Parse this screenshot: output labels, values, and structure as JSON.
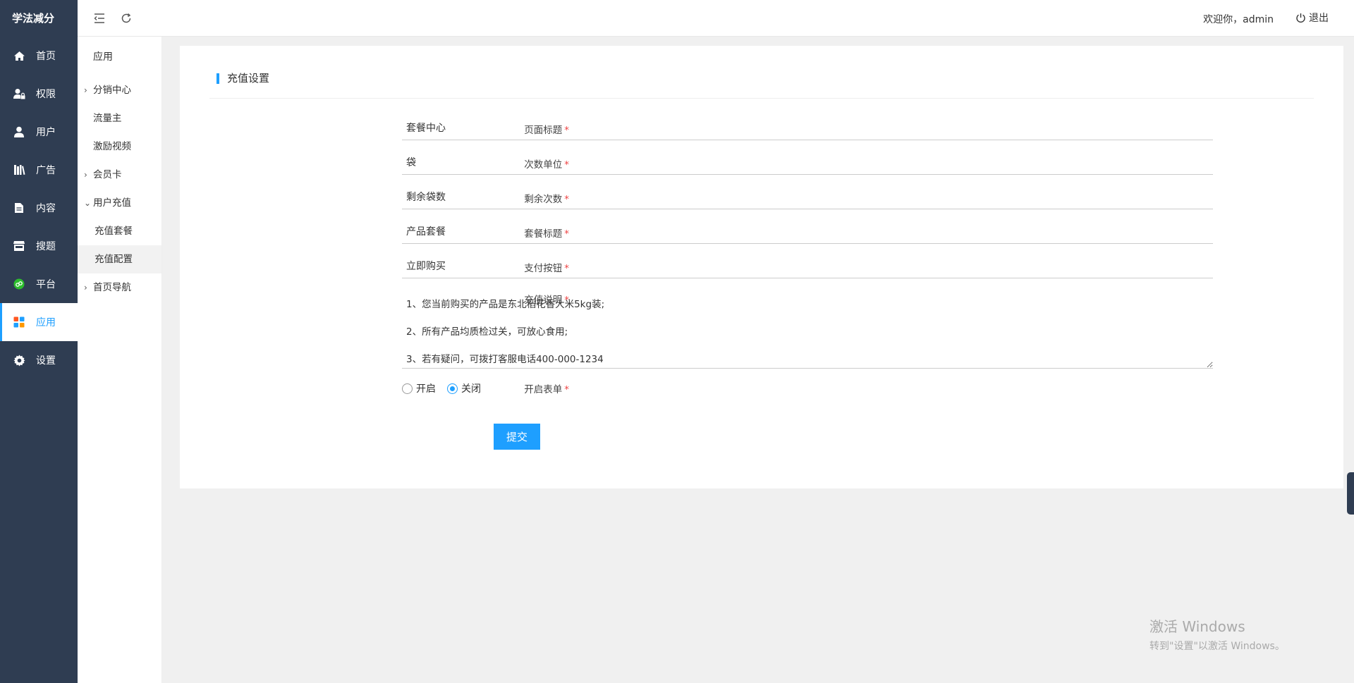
{
  "app": {
    "logo": "学法减分"
  },
  "sidebar": {
    "items": [
      {
        "label": "首页",
        "icon": "home-icon"
      },
      {
        "label": "权限",
        "icon": "user-lock-icon"
      },
      {
        "label": "用户",
        "icon": "user-icon"
      },
      {
        "label": "广告",
        "icon": "books-icon"
      },
      {
        "label": "内容",
        "icon": "document-icon"
      },
      {
        "label": "搜题",
        "icon": "store-icon"
      },
      {
        "label": "平台",
        "icon": "platform-icon"
      },
      {
        "label": "应用",
        "icon": "apps-icon",
        "active": true
      },
      {
        "label": "设置",
        "icon": "gear-icon"
      }
    ]
  },
  "subnav": {
    "title": "应用",
    "items": [
      {
        "label": "分销中心",
        "expandable": true
      },
      {
        "label": "流量主"
      },
      {
        "label": "激励视频"
      },
      {
        "label": "会员卡",
        "expandable": true
      },
      {
        "label": "用户充值",
        "expanded": true
      },
      {
        "label": "充值套餐",
        "child": true
      },
      {
        "label": "充值配置",
        "child": true,
        "selected": true
      },
      {
        "label": "首页导航",
        "expandable": true
      }
    ]
  },
  "topbar": {
    "welcome": "欢迎你，admin",
    "logout": "退出"
  },
  "form": {
    "section_title": "充值设置",
    "fields": {
      "page_title": {
        "label": "页面标题",
        "value": "套餐中心"
      },
      "count_unit": {
        "label": "次数单位",
        "value": "袋"
      },
      "remaining": {
        "label": "剩余次数",
        "value": "剩余袋数"
      },
      "package_title": {
        "label": "套餐标题",
        "value": "产品套餐"
      },
      "pay_button": {
        "label": "支付按钮",
        "value": "立即购买"
      },
      "description": {
        "label": "充值说明",
        "value": "1、您当前购买的产品是东北稻花香大米5kg装;\n2、所有产品均质检过关，可放心食用;\n3、若有疑问，可拨打客服电话400-000-1234"
      },
      "enable_form": {
        "label": "开启表单",
        "options": [
          "开启",
          "关闭"
        ],
        "selected": "关闭"
      }
    },
    "required_mark": "*",
    "submit": "提交"
  },
  "watermark": {
    "line1": "激活 Windows",
    "line2": "转到\"设置\"以激活 Windows。"
  },
  "colors": {
    "sidebar_bg": "#2f3d52",
    "accent": "#1e9fff",
    "required": "#e44"
  }
}
